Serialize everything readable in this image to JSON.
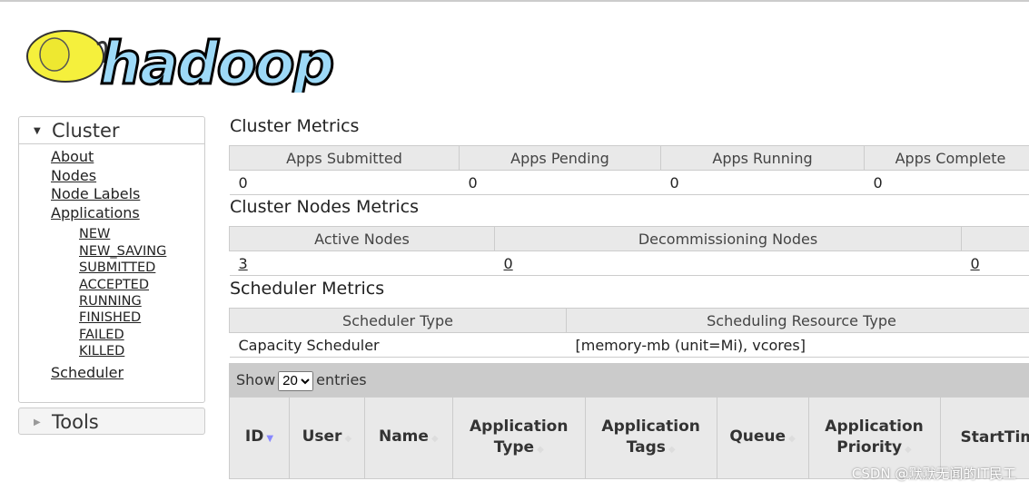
{
  "logo": {
    "text": "hadoop"
  },
  "sidebar": {
    "cluster": "Cluster",
    "links": [
      "About",
      "Nodes",
      "Node Labels",
      "Applications"
    ],
    "app_states": [
      "NEW",
      "NEW_SAVING",
      "SUBMITTED",
      "ACCEPTED",
      "RUNNING",
      "FINISHED",
      "FAILED",
      "KILLED"
    ],
    "scheduler": "Scheduler",
    "tools": "Tools"
  },
  "cluster_metrics": {
    "title": "Cluster Metrics",
    "headers": [
      "Apps Submitted",
      "Apps Pending",
      "Apps Running",
      "Apps Complete"
    ],
    "values": [
      "0",
      "0",
      "0",
      "0"
    ]
  },
  "node_metrics": {
    "title": "Cluster Nodes Metrics",
    "headers": [
      "Active Nodes",
      "Decommissioning Nodes",
      ""
    ],
    "values": [
      "3",
      "0",
      "0"
    ]
  },
  "scheduler_metrics": {
    "title": "Scheduler Metrics",
    "headers": [
      "Scheduler Type",
      "Scheduling Resource Type"
    ],
    "values": [
      "Capacity Scheduler",
      "[memory-mb (unit=Mi), vcores]"
    ]
  },
  "apps_table": {
    "show": "Show",
    "entries": "entries",
    "page_size": "20",
    "headers": [
      "ID",
      "User",
      "Name",
      "Application Type",
      "Application Tags",
      "Queue",
      "Application Priority",
      "StartTim"
    ]
  },
  "watermark": "CSDN @默默无闻的IT民工"
}
